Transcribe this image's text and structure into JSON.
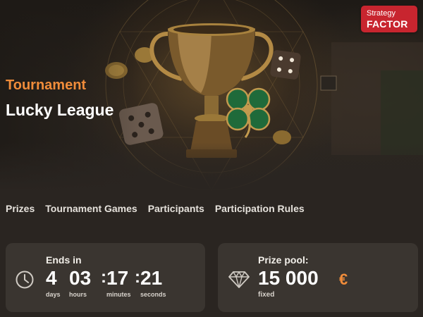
{
  "brand": {
    "line1": "Strategy",
    "line2": "FACTOR"
  },
  "hero": {
    "kicker": "Tournament",
    "title": "Lucky League"
  },
  "tabs": [
    {
      "label": "Prizes"
    },
    {
      "label": "Tournament Games"
    },
    {
      "label": "Participants"
    },
    {
      "label": "Participation Rules"
    }
  ],
  "timer": {
    "label": "Ends in",
    "icon": "clock-icon",
    "days": "4",
    "days_unit": "days",
    "hours": "03",
    "hours_unit": "hours",
    "minutes": "17",
    "minutes_unit": "minutes",
    "seconds": "21",
    "seconds_unit": "seconds"
  },
  "prize": {
    "label": "Prize pool:",
    "icon": "diamond-icon",
    "amount": "15 000",
    "currency": "€",
    "note": "fixed"
  },
  "colors": {
    "accent": "#f08c3a",
    "brand": "#c8252f",
    "card": "#3a3530",
    "background": "#2a2521"
  }
}
